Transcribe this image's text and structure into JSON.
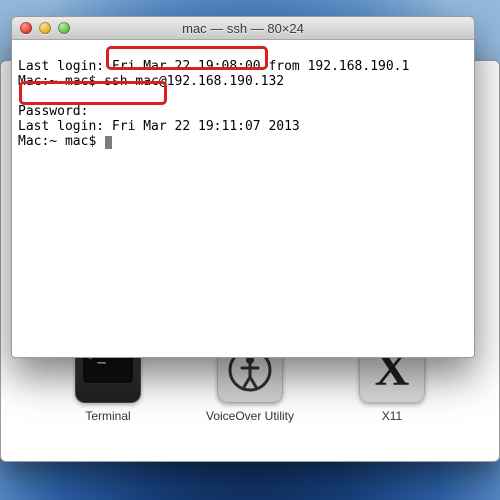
{
  "window": {
    "title": "mac — ssh — 80×24"
  },
  "terminal": {
    "line1_a": "Last login: Fri Mar 22 19:08:00 from 192.168.190.1",
    "line2_prompt": "Mac:~ mac$ ",
    "line2_cmd": "ssh mac@192.168.190.132",
    "line3_blank": " ",
    "line4": "Password:",
    "line5": "Last login: Fri Mar 22 19:11:07 2013",
    "line6_prompt": "Mac:~ mac$ "
  },
  "apps": {
    "terminal": "Terminal",
    "voiceover": "VoiceOver Utility",
    "x11": "X11"
  }
}
